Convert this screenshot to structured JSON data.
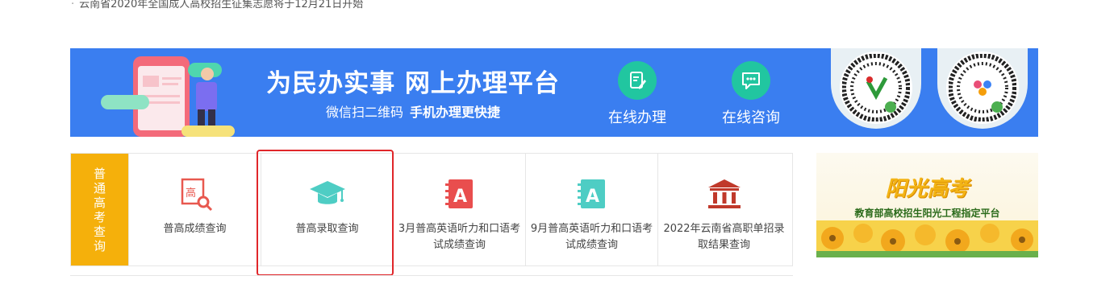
{
  "notice": {
    "text": "云南省2020年全国成人高校招生征集志愿将于12月21日开始"
  },
  "banner": {
    "slogan": "为民办实事  网上办理平台",
    "sub_prefix": "微信扫二维码",
    "sub_emph": "手机办理更快捷",
    "services": [
      {
        "label": "在线办理",
        "icon": "edit-document-icon"
      },
      {
        "label": "在线咨询",
        "icon": "chat-bubble-icon"
      }
    ]
  },
  "grid": {
    "category": [
      "普",
      "通",
      "高",
      "考",
      "查",
      "询"
    ],
    "items": [
      {
        "label": "普高成绩查询",
        "icon": "score-search-icon"
      },
      {
        "label": "普高录取查询",
        "icon": "graduation-cap-icon"
      },
      {
        "label": "3月普高英语听力和口语考试成绩查询",
        "icon": "english-test-a-icon"
      },
      {
        "label": "9月普高英语听力和口语考试成绩查询",
        "icon": "english-test-a-icon"
      },
      {
        "label": "2022年云南省高职单招录取结果查询",
        "icon": "institution-building-icon"
      }
    ]
  },
  "ad": {
    "title": "阳光高考",
    "tagline": "教育部高校招生阳光工程指定平台"
  },
  "colors": {
    "banner_blue": "#3a7ef0",
    "teal": "#21c6a0",
    "category_orange": "#f5b00b",
    "highlight_red": "#e0262a"
  }
}
